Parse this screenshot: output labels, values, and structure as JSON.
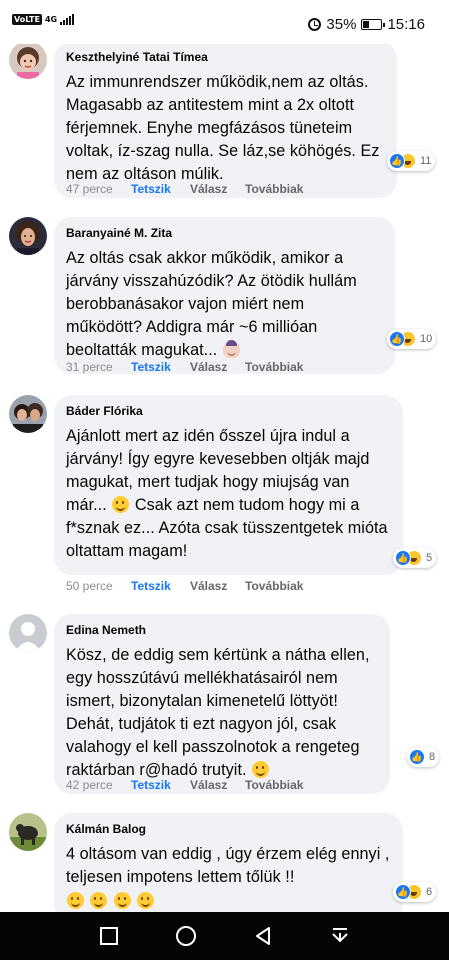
{
  "status_bar": {
    "carrier_badge": "VoLTE",
    "network": "4G",
    "battery": "35%",
    "battery_level": 0.35,
    "time": "15:16"
  },
  "comments": [
    {
      "author": "Keszthelyiné Tatai Tímea",
      "text": "Az immunrendszer működik,nem az oltás. Magasabb az antitestem mint a 2x oltott férjemnek. Enyhe megfázásos tüneteim voltak, íz-szag nulla. Se láz,se köhögés. Ez nem az oltáson múlik.",
      "time": "47 perce",
      "like": "Tetszik",
      "reply": "Válasz",
      "more": "Továbbiak",
      "reaction_count": "11",
      "reactions": [
        "like",
        "haha"
      ]
    },
    {
      "author": "Baranyainé M. Zita",
      "text": "Az oltás csak akkor működik, amikor a járvány visszahúzódik? Az ötödik hullám berobbanásakor vajon miért nem működött? Addigra már ~6 millióan beoltatták magukat...",
      "time": "31 perce",
      "like": "Tetszik",
      "reply": "Válasz",
      "more": "Továbbiak",
      "reaction_count": "10",
      "reactions": [
        "like",
        "haha"
      ]
    },
    {
      "author": "Báder Flórika",
      "text_a": "Ajánlott mert az idén ősszel újra indul a járvány! Így egyre kevesebben oltják majd magukat, mert tudjak hogy miujság van már...",
      "text_b": "Csak azt nem tudom hogy mi a f*sznak ez... Azóta csak tüsszentgetek mióta oltattam magam!",
      "time": "50 perce",
      "like": "Tetszik",
      "reply": "Válasz",
      "more": "Továbbiak",
      "reaction_count": "5",
      "reactions": [
        "like",
        "haha"
      ]
    },
    {
      "author": "Edina Nemeth",
      "text": "Kösz, de eddig sem kértünk a nátha ellen, egy hosszútávú mellékhatásairól nem ismert, bizonytalan kimenetelű löttyöt! Dehát, tudjátok ti ezt nagyon jól, csak valahogy el kell passzolnotok a rengeteg raktárban r@hadó trutyit.",
      "time": "42 perce",
      "like": "Tetszik",
      "reply": "Válasz",
      "more": "Továbbiak",
      "reaction_count": "8",
      "reactions": [
        "like"
      ]
    },
    {
      "author": "Kálmán Balog",
      "text": "4 oltásom van eddig , úgy érzem elég ennyi , teljesen impotens lettem tőlük !!",
      "reaction_count": "6",
      "reactions": [
        "like",
        "haha"
      ]
    }
  ],
  "colors": {
    "bubble": "#f0f2f5",
    "link_blue": "#1877f2",
    "meta_gray": "#8a8d91"
  }
}
